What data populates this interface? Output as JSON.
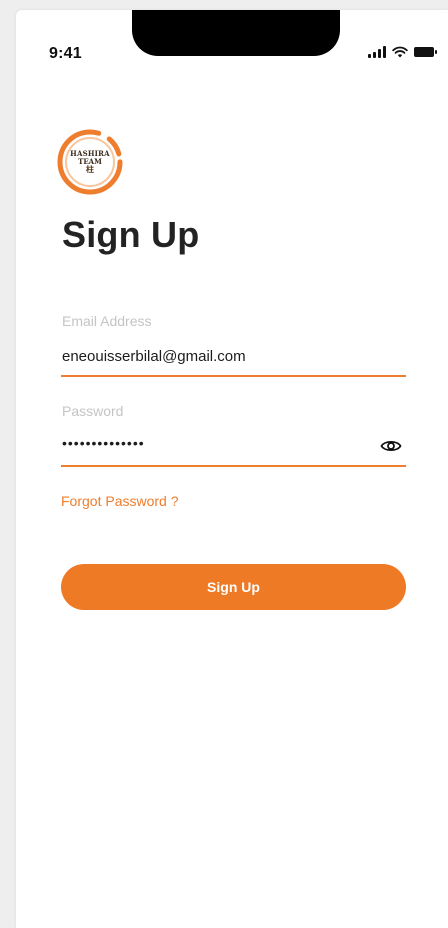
{
  "status_bar": {
    "time": "9:41",
    "icons": [
      "signal-icon",
      "wifi-icon",
      "battery-icon"
    ]
  },
  "logo": {
    "line1": "HASHIRA",
    "line2": "TEAM",
    "line3": "柱",
    "ring_color": "#ee7d2e"
  },
  "title": "Sign Up",
  "email": {
    "label": "Email Address",
    "value": "eneouisserbilal@gmail.com"
  },
  "password": {
    "label": "Password",
    "value": "••••••••••••••",
    "toggle_icon": "eye-icon"
  },
  "forgot_link": "Forgot Password ?",
  "submit_label": "Sign Up",
  "colors": {
    "accent": "#ee7d2e",
    "title": "#232323",
    "placeholder": "#c4c4c4",
    "background": "#ffffff"
  }
}
